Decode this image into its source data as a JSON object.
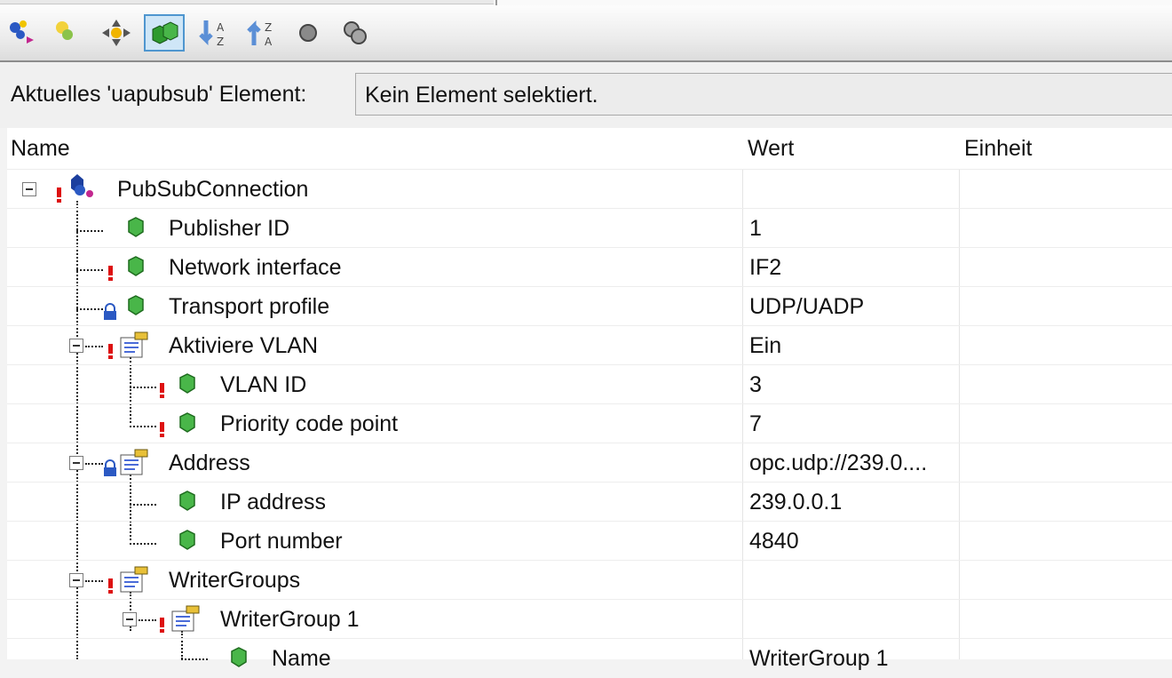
{
  "toolbar": {
    "buttons": [
      {
        "name": "add-connection-icon"
      },
      {
        "name": "add-item-icon"
      },
      {
        "name": "navigate-icon"
      },
      {
        "name": "show-parameters-icon",
        "active": true
      },
      {
        "name": "sort-ascending-icon"
      },
      {
        "name": "sort-descending-icon"
      },
      {
        "name": "circle-icon"
      },
      {
        "name": "circles-icon"
      }
    ]
  },
  "current": {
    "label": "Aktuelles 'uapubsub' Element:",
    "value": "Kein Element selektiert."
  },
  "grid": {
    "columns": [
      "Name",
      "Wert",
      "Einheit"
    ],
    "rows": [
      {
        "name": "PubSubConnection",
        "value": ""
      },
      {
        "name": "Publisher ID",
        "value": "1"
      },
      {
        "name": "Network interface",
        "value": "IF2"
      },
      {
        "name": "Transport profile",
        "value": "UDP/UADP"
      },
      {
        "name": "Aktiviere VLAN",
        "value": "Ein"
      },
      {
        "name": "VLAN ID",
        "value": "3"
      },
      {
        "name": "Priority code point",
        "value": "7"
      },
      {
        "name": "Address",
        "value": "opc.udp://239.0...."
      },
      {
        "name": "IP address",
        "value": "239.0.0.1"
      },
      {
        "name": "Port number",
        "value": "4840"
      },
      {
        "name": "WriterGroups",
        "value": ""
      },
      {
        "name": "WriterGroup 1",
        "value": ""
      },
      {
        "name": "Name",
        "value": "WriterGroup 1"
      }
    ]
  },
  "colors": {
    "accent": "#4f96cf",
    "error": "#d11111",
    "param": "#3aa23a"
  }
}
